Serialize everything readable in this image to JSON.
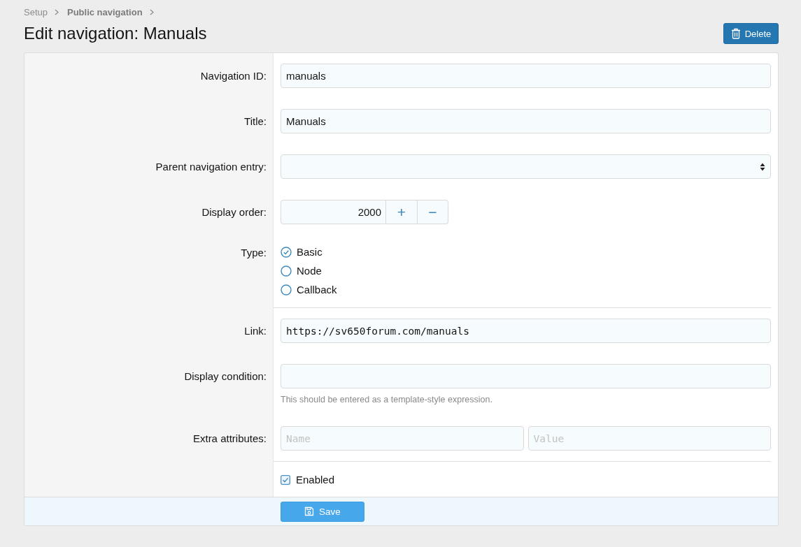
{
  "breadcrumb": [
    {
      "label": "Setup",
      "current": false
    },
    {
      "label": "Public navigation",
      "current": true
    }
  ],
  "page_title": "Edit navigation: Manuals",
  "delete_button": {
    "label": "Delete"
  },
  "form": {
    "rows": [
      {
        "kind": "text",
        "label": "Navigation ID:",
        "value": "manuals"
      },
      {
        "kind": "text",
        "label": "Title:",
        "value": "Manuals"
      },
      {
        "kind": "select",
        "label": "Parent navigation entry:"
      },
      {
        "kind": "number",
        "label": "Display order:",
        "value": "2000",
        "buttons": [
          "+",
          "−"
        ]
      },
      {
        "kind": "radio",
        "label": "Type:",
        "options": [
          {
            "label": "Basic",
            "selected": true
          },
          {
            "label": "Node",
            "selected": false
          },
          {
            "label": "Callback",
            "selected": false
          }
        ]
      },
      {
        "kind": "code",
        "label": "Link:",
        "value": "https://sv650forum.com/manuals",
        "divider_before": true
      },
      {
        "kind": "text",
        "label": "Display condition:",
        "hint": "This should be entered as a template-style expression."
      },
      {
        "kind": "pair",
        "label": "Extra attributes:",
        "fields": [
          {
            "placeholder": "Name"
          },
          {
            "placeholder": "Value"
          }
        ]
      },
      {
        "kind": "checkbox",
        "label": "Enabled",
        "checked": true,
        "divider_before": true
      }
    ]
  },
  "footer": {
    "save_button": {
      "label": "Save"
    }
  }
}
